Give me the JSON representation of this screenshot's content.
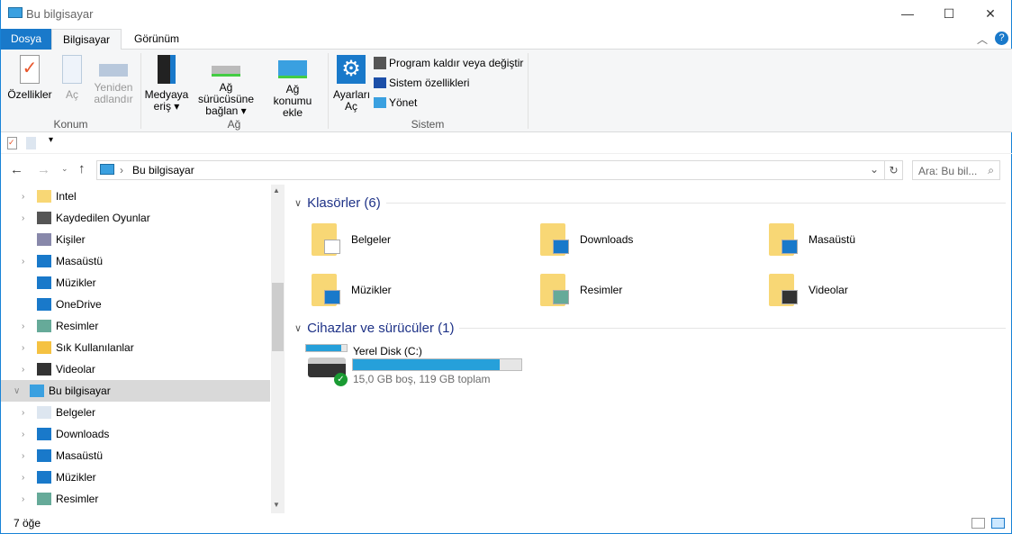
{
  "window": {
    "title": "Bu bilgisayar",
    "minimize": "—",
    "maximize": "☐",
    "close": "✕"
  },
  "tabs": [
    {
      "label": "Dosya"
    },
    {
      "label": "Bilgisayar"
    },
    {
      "label": "Görünüm"
    }
  ],
  "ribbon": {
    "konum": {
      "label": "Konum",
      "buttons": [
        {
          "label": "Özellikler"
        },
        {
          "label": "Aç"
        },
        {
          "label": "Yeniden adlandır"
        }
      ]
    },
    "ag": {
      "label": "Ağ",
      "buttons": [
        {
          "label": "Medyaya eriş ▾"
        },
        {
          "label": "Ağ sürücüsüne bağlan ▾"
        },
        {
          "label": "Ağ konumu ekle"
        }
      ]
    },
    "sistem": {
      "label": "Sistem",
      "settings": "Ayarları Aç",
      "small": [
        {
          "label": "Program kaldır veya değiştir"
        },
        {
          "label": "Sistem özellikleri"
        },
        {
          "label": "Yönet"
        }
      ]
    }
  },
  "address": {
    "path": "Bu bilgisayar",
    "search_placeholder": "Ara: Bu bil..."
  },
  "nav": {
    "items": [
      {
        "label": "Intel",
        "icon": "folder-icon",
        "chev": true
      },
      {
        "label": "Kaydedilen Oyunlar",
        "icon": "games-icon",
        "chev": true
      },
      {
        "label": "Kişiler",
        "icon": "contacts-icon",
        "chev": false
      },
      {
        "label": "Masaüstü",
        "icon": "desktop-icon",
        "chev": true
      },
      {
        "label": "Müzikler",
        "icon": "music-icon",
        "chev": false
      },
      {
        "label": "OneDrive",
        "icon": "onedrive-icon",
        "chev": false
      },
      {
        "label": "Resimler",
        "icon": "pictures-icon",
        "chev": true
      },
      {
        "label": "Sık Kullanılanlar",
        "icon": "star-icon",
        "chev": true
      },
      {
        "label": "Videolar",
        "icon": "videos-icon",
        "chev": true
      },
      {
        "label": "Bu bilgisayar",
        "icon": "computer-icon",
        "chev": true,
        "selected": true
      },
      {
        "label": "Belgeler",
        "icon": "documents-icon",
        "chev": true
      },
      {
        "label": "Downloads",
        "icon": "downloads-icon",
        "chev": true
      },
      {
        "label": "Masaüstü",
        "icon": "desktop-icon",
        "chev": true
      },
      {
        "label": "Müzikler",
        "icon": "music-icon",
        "chev": true
      },
      {
        "label": "Resimler",
        "icon": "pictures-icon",
        "chev": true
      }
    ]
  },
  "folders": {
    "title": "Klasörler (6)",
    "items": [
      {
        "label": "Belgeler"
      },
      {
        "label": "Downloads"
      },
      {
        "label": "Masaüstü"
      },
      {
        "label": "Müzikler"
      },
      {
        "label": "Resimler"
      },
      {
        "label": "Videolar"
      }
    ]
  },
  "devices": {
    "title": "Cihazlar ve sürücüler (1)",
    "items": [
      {
        "label": "Yerel Disk (C:)",
        "info": "15,0 GB boş, 119 GB toplam",
        "used_fraction": 0.874
      }
    ]
  },
  "status": {
    "count": "7 öğe"
  },
  "colors": {
    "accent": "#1979ca",
    "bar": "#26a0da",
    "folder": "#f8d775"
  }
}
